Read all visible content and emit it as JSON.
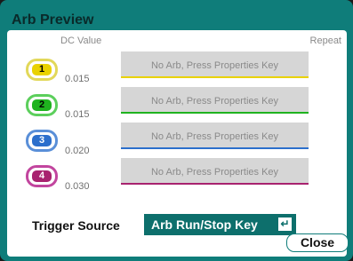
{
  "dialog": {
    "title": "Arb Preview"
  },
  "headers": {
    "dc_value": "DC Value",
    "repeat": "Repeat"
  },
  "channels": [
    {
      "number": "1",
      "dc_value": "0.015",
      "arb_text": "No Arb, Press Properties Key",
      "color": "#e9d200"
    },
    {
      "number": "2",
      "dc_value": "0.015",
      "arb_text": "No Arb, Press Properties Key",
      "color": "#1fb31f"
    },
    {
      "number": "3",
      "dc_value": "0.020",
      "arb_text": "No Arb, Press Properties Key",
      "color": "#2c6fcc"
    },
    {
      "number": "4",
      "dc_value": "0.030",
      "arb_text": "No Arb, Press Properties Key",
      "color": "#a8226f"
    }
  ],
  "trigger": {
    "label": "Trigger Source",
    "value": "Arb Run/Stop Key",
    "icon": "enter-icon"
  },
  "close_button": {
    "label": "Close"
  }
}
